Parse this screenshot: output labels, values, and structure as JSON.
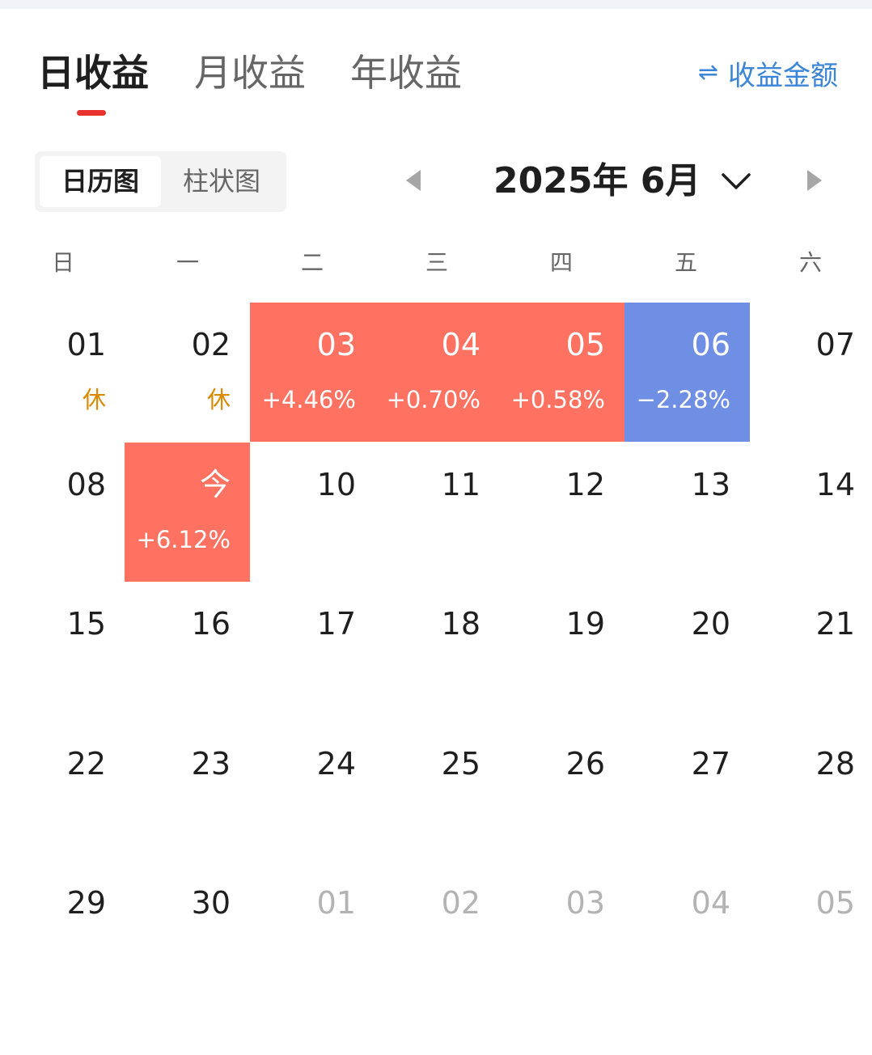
{
  "tabs": [
    {
      "label": "日收益",
      "active": true
    },
    {
      "label": "月收益",
      "active": false
    },
    {
      "label": "年收益",
      "active": false
    }
  ],
  "toggle": {
    "icon": "swap-arrows-icon",
    "label": "收益金额"
  },
  "view_switch": [
    {
      "label": "日历图",
      "active": true
    },
    {
      "label": "柱状图",
      "active": false
    }
  ],
  "month_nav": {
    "label": "2025年 6月"
  },
  "weekdays": [
    "日",
    "一",
    "二",
    "三",
    "四",
    "五",
    "六"
  ],
  "colors": {
    "up": "#ff7261",
    "down": "#6f8fe5",
    "rest": "#d98a00",
    "accent": "#3a85d8",
    "indicator": "#e8322f"
  },
  "weeks": [
    [
      {
        "date": "01",
        "sub": "休",
        "kind": "rest"
      },
      {
        "date": "02",
        "sub": "休",
        "kind": "rest"
      },
      {
        "date": "03",
        "sub": "+4.46%",
        "kind": "up"
      },
      {
        "date": "04",
        "sub": "+0.70%",
        "kind": "up"
      },
      {
        "date": "05",
        "sub": "+0.58%",
        "kind": "up"
      },
      {
        "date": "06",
        "sub": "−2.28%",
        "kind": "down"
      },
      {
        "date": "07",
        "sub": "",
        "kind": "normal"
      }
    ],
    [
      {
        "date": "08",
        "sub": "",
        "kind": "normal"
      },
      {
        "date": "今",
        "sub": "+6.12%",
        "kind": "up"
      },
      {
        "date": "10",
        "sub": "",
        "kind": "normal"
      },
      {
        "date": "11",
        "sub": "",
        "kind": "normal"
      },
      {
        "date": "12",
        "sub": "",
        "kind": "normal"
      },
      {
        "date": "13",
        "sub": "",
        "kind": "normal"
      },
      {
        "date": "14",
        "sub": "",
        "kind": "normal"
      }
    ],
    [
      {
        "date": "15",
        "sub": "",
        "kind": "normal"
      },
      {
        "date": "16",
        "sub": "",
        "kind": "normal"
      },
      {
        "date": "17",
        "sub": "",
        "kind": "normal"
      },
      {
        "date": "18",
        "sub": "",
        "kind": "normal"
      },
      {
        "date": "19",
        "sub": "",
        "kind": "normal"
      },
      {
        "date": "20",
        "sub": "",
        "kind": "normal"
      },
      {
        "date": "21",
        "sub": "",
        "kind": "normal"
      }
    ],
    [
      {
        "date": "22",
        "sub": "",
        "kind": "normal"
      },
      {
        "date": "23",
        "sub": "",
        "kind": "normal"
      },
      {
        "date": "24",
        "sub": "",
        "kind": "normal"
      },
      {
        "date": "25",
        "sub": "",
        "kind": "normal"
      },
      {
        "date": "26",
        "sub": "",
        "kind": "normal"
      },
      {
        "date": "27",
        "sub": "",
        "kind": "normal"
      },
      {
        "date": "28",
        "sub": "",
        "kind": "normal"
      }
    ],
    [
      {
        "date": "29",
        "sub": "",
        "kind": "normal"
      },
      {
        "date": "30",
        "sub": "",
        "kind": "normal"
      },
      {
        "date": "01",
        "sub": "",
        "kind": "other"
      },
      {
        "date": "02",
        "sub": "",
        "kind": "other"
      },
      {
        "date": "03",
        "sub": "",
        "kind": "other"
      },
      {
        "date": "04",
        "sub": "",
        "kind": "other"
      },
      {
        "date": "05",
        "sub": "",
        "kind": "other"
      }
    ]
  ]
}
